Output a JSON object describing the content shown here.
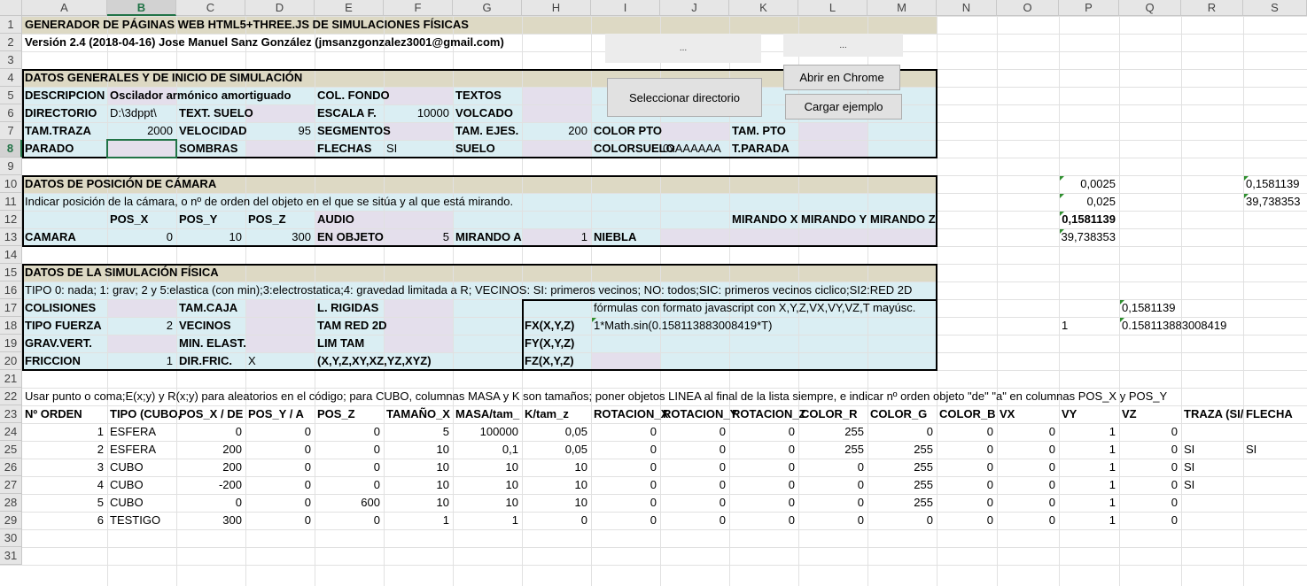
{
  "columns": [
    "A",
    "B",
    "C",
    "D",
    "E",
    "F",
    "G",
    "H",
    "I",
    "J",
    "K",
    "L",
    "M",
    "N",
    "O",
    "P",
    "Q",
    "R",
    "S"
  ],
  "rows": [
    "1",
    "2",
    "3",
    "4",
    "5",
    "6",
    "7",
    "8",
    "9",
    "10",
    "11",
    "12",
    "13",
    "14",
    "15",
    "16",
    "17",
    "18",
    "19",
    "20",
    "21",
    "22",
    "23",
    "24",
    "25",
    "26",
    "27",
    "28",
    "29",
    "30",
    "31"
  ],
  "buttons": {
    "select_dir": "Seleccionar directorio",
    "open_chrome": "Abrir en Chrome",
    "load_example": "Cargar ejemplo",
    "gray1": "...",
    "gray2": "..."
  },
  "cells": [
    [
      "A",
      1,
      "GENERADOR DE PÁGINAS WEB HTML5+THREE.JS DE SIMULACIONES FÍSICAS",
      "b"
    ],
    [
      "A",
      2,
      "Versión 2.4 (2018-04-16) Jose Manuel Sanz González (jmsanzgonzalez3001@gmail.com)",
      "b"
    ],
    [
      "A",
      4,
      "DATOS GENERALES Y DE INICIO DE SIMULACIÓN",
      "b"
    ],
    [
      "A",
      5,
      "DESCRIPCION",
      "b"
    ],
    [
      "B",
      5,
      "Oscilador armónico amortiguado",
      "b"
    ],
    [
      "E",
      5,
      "COL. FONDO",
      "b"
    ],
    [
      "G",
      5,
      "TEXTOS",
      "b"
    ],
    [
      "A",
      6,
      "DIRECTORIO",
      "b"
    ],
    [
      "B",
      6,
      "D:\\3dppt\\",
      ""
    ],
    [
      "C",
      6,
      "TEXT. SUELO",
      "b"
    ],
    [
      "E",
      6,
      "ESCALA F.",
      "b"
    ],
    [
      "F",
      6,
      "10000",
      "r"
    ],
    [
      "G",
      6,
      "VOLCADO",
      "b"
    ],
    [
      "A",
      7,
      "TAM.TRAZA",
      "b"
    ],
    [
      "B",
      7,
      "2000",
      "r"
    ],
    [
      "C",
      7,
      "VELOCIDAD",
      "b"
    ],
    [
      "D",
      7,
      "95",
      "r"
    ],
    [
      "E",
      7,
      "SEGMENTOS",
      "b"
    ],
    [
      "G",
      7,
      "TAM. EJES.",
      "b"
    ],
    [
      "H",
      7,
      "200",
      "r"
    ],
    [
      "I",
      7,
      "COLOR PTO",
      "b"
    ],
    [
      "K",
      7,
      "TAM. PTO",
      "b"
    ],
    [
      "A",
      8,
      "PARADO",
      "b"
    ],
    [
      "C",
      8,
      "SOMBRAS",
      "b"
    ],
    [
      "E",
      8,
      "FLECHAS",
      "b"
    ],
    [
      "F",
      8,
      "SI",
      ""
    ],
    [
      "G",
      8,
      "SUELO",
      "b"
    ],
    [
      "I",
      8,
      "COLORSUELO",
      "b"
    ],
    [
      "J",
      8,
      "0xAAAAAA",
      ""
    ],
    [
      "K",
      8,
      "T.PARADA",
      "b"
    ],
    [
      "A",
      10,
      "DATOS DE POSICIÓN DE CÁMARA",
      "b"
    ],
    [
      "P",
      10,
      "0,0025",
      "r"
    ],
    [
      "S",
      10,
      "0,1581139",
      ""
    ],
    [
      "A",
      11,
      "Indicar posición de la cámara, o nº de orden del objeto en el que se sitúa y al que está mirando.",
      ""
    ],
    [
      "P",
      11,
      "0,025",
      "r"
    ],
    [
      "S",
      11,
      "39,738353",
      ""
    ],
    [
      "B",
      12,
      "POS_X",
      "b"
    ],
    [
      "C",
      12,
      "POS_Y",
      "b"
    ],
    [
      "D",
      12,
      "POS_Z",
      "b"
    ],
    [
      "E",
      12,
      "AUDIO",
      "b"
    ],
    [
      "K",
      12,
      "MIRANDO X",
      "b"
    ],
    [
      "L",
      12,
      "MIRANDO Y",
      "b"
    ],
    [
      "M",
      12,
      "MIRANDO Z",
      "b"
    ],
    [
      "P",
      12,
      "0,1581139",
      "b r"
    ],
    [
      "A",
      13,
      "CAMARA",
      "b"
    ],
    [
      "B",
      13,
      "0",
      "r"
    ],
    [
      "C",
      13,
      "10",
      "r"
    ],
    [
      "D",
      13,
      "300",
      "r"
    ],
    [
      "E",
      13,
      "EN OBJETO",
      "b"
    ],
    [
      "F",
      13,
      "5",
      "r"
    ],
    [
      "G",
      13,
      "MIRANDO A",
      "b"
    ],
    [
      "H",
      13,
      "1",
      "r"
    ],
    [
      "I",
      13,
      "NIEBLA",
      "b"
    ],
    [
      "P",
      13,
      "39,738353",
      "r"
    ],
    [
      "A",
      15,
      "DATOS DE LA SIMULACIÓN FÍSICA",
      "b"
    ],
    [
      "A",
      16,
      "TIPO 0: nada; 1: grav; 2 y 5:elastica (con min);3:electrostatica;4: gravedad limitada a R; VECINOS: SI: primeros vecinos; NO: todos;SIC: primeros vecinos ciclico;SI2:RED 2D",
      ""
    ],
    [
      "A",
      17,
      "COLISIONES",
      "b"
    ],
    [
      "C",
      17,
      "TAM.CAJA",
      "b"
    ],
    [
      "E",
      17,
      "L. RIGIDAS",
      "b"
    ],
    [
      "I",
      17,
      "fórmulas con formato javascript con X,Y,Z,VX,VY,VZ,T mayúsc.",
      ""
    ],
    [
      "Q",
      17,
      "0,1581139",
      ""
    ],
    [
      "A",
      18,
      "TIPO FUERZA",
      "b"
    ],
    [
      "B",
      18,
      "2",
      "r"
    ],
    [
      "C",
      18,
      "VECINOS",
      "b"
    ],
    [
      "E",
      18,
      "TAM RED 2D",
      "b"
    ],
    [
      "H",
      18,
      "FX(X,Y,Z)",
      "b"
    ],
    [
      "I",
      18,
      "1*Math.sin(0.158113883008419*T)",
      ""
    ],
    [
      "P",
      18,
      "1",
      ""
    ],
    [
      "Q",
      18,
      "0.158113883008419",
      ""
    ],
    [
      "A",
      19,
      "GRAV.VERT.",
      "b"
    ],
    [
      "C",
      19,
      "MIN. ELAST.",
      "b"
    ],
    [
      "E",
      19,
      "LIM TAM",
      "b"
    ],
    [
      "H",
      19,
      "FY(X,Y,Z)",
      "b"
    ],
    [
      "A",
      20,
      "FRICCION",
      "b"
    ],
    [
      "B",
      20,
      "1",
      "r"
    ],
    [
      "C",
      20,
      "DIR.FRIC.",
      "b"
    ],
    [
      "D",
      20,
      "X",
      ""
    ],
    [
      "E",
      20,
      "(X,Y,Z,XY,XZ,YZ,XYZ)",
      "b"
    ],
    [
      "H",
      20,
      "FZ(X,Y,Z)",
      "b"
    ],
    [
      "A",
      22,
      "Usar punto o coma;E(x;y) y R(x;y) para aleatorios en el código; para CUBO, columnas MASA y K son tamaños; poner objetos LINEA al final de la lista siempre, e indicar nº orden objeto \"de\" \"a\" en columnas POS_X y POS_Y",
      ""
    ],
    [
      "A",
      23,
      "Nº ORDEN",
      "b"
    ],
    [
      "B",
      23,
      "TIPO (CUBO,",
      "b"
    ],
    [
      "C",
      23,
      "POS_X / DE",
      "b"
    ],
    [
      "D",
      23,
      "POS_Y / A",
      "b"
    ],
    [
      "E",
      23,
      "POS_Z",
      "b"
    ],
    [
      "F",
      23,
      "TAMAÑO_X",
      "b"
    ],
    [
      "G",
      23,
      "MASA/tam_",
      "b"
    ],
    [
      "H",
      23,
      "K/tam_z",
      "b"
    ],
    [
      "I",
      23,
      "ROTACION_X",
      "b"
    ],
    [
      "J",
      23,
      "ROTACION_Y",
      "b"
    ],
    [
      "K",
      23,
      "ROTACION_Z",
      "b"
    ],
    [
      "L",
      23,
      "COLOR_R",
      "b"
    ],
    [
      "M",
      23,
      "COLOR_G",
      "b"
    ],
    [
      "N",
      23,
      "COLOR_B",
      "b"
    ],
    [
      "O",
      23,
      "VX",
      "b"
    ],
    [
      "P",
      23,
      "VY",
      "b"
    ],
    [
      "Q",
      23,
      "VZ",
      "b"
    ],
    [
      "R",
      23,
      "TRAZA (SI/",
      "b"
    ],
    [
      "S",
      23,
      "FLECHA",
      "b"
    ]
  ],
  "table": [
    [
      "1",
      "ESFERA",
      "0",
      "0",
      "0",
      "5",
      "100000",
      "0,05",
      "0",
      "0",
      "0",
      "255",
      "0",
      "0",
      "0",
      "1",
      "0",
      "",
      ""
    ],
    [
      "2",
      "ESFERA",
      "200",
      "0",
      "0",
      "10",
      "0,1",
      "0,05",
      "0",
      "0",
      "0",
      "255",
      "255",
      "0",
      "0",
      "1",
      "0",
      "SI",
      "SI"
    ],
    [
      "3",
      "CUBO",
      "200",
      "0",
      "0",
      "10",
      "10",
      "10",
      "0",
      "0",
      "0",
      "0",
      "255",
      "0",
      "0",
      "1",
      "0",
      "SI",
      ""
    ],
    [
      "4",
      "CUBO",
      "-200",
      "0",
      "0",
      "10",
      "10",
      "10",
      "0",
      "0",
      "0",
      "0",
      "255",
      "0",
      "0",
      "1",
      "0",
      "SI",
      ""
    ],
    [
      "5",
      "CUBO",
      "0",
      "0",
      "600",
      "10",
      "10",
      "10",
      "0",
      "0",
      "0",
      "0",
      "255",
      "0",
      "0",
      "1",
      "0",
      "",
      ""
    ],
    [
      "6",
      "TESTIGO",
      "300",
      "0",
      "0",
      "1",
      "1",
      "0",
      "0",
      "0",
      "0",
      "0",
      "0",
      "0",
      "0",
      "1",
      "0",
      "",
      ""
    ]
  ]
}
